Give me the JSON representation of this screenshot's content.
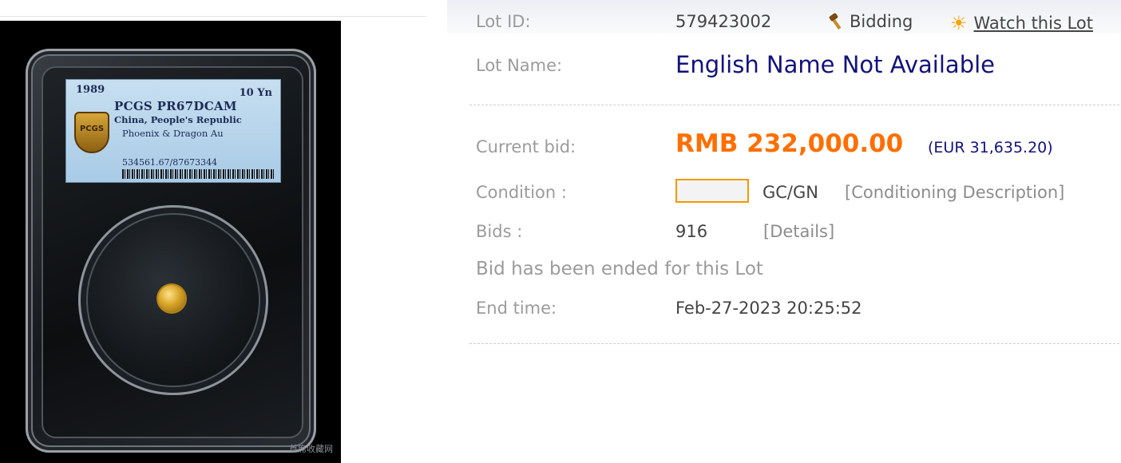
{
  "lot_image": {
    "slab_label": {
      "year": "1989",
      "denomination": "10 Yn",
      "grade": "PCGS PR67DCAM",
      "country": "China, People's Republic",
      "variety": "Phoenix & Dragon Au",
      "cert_number": "534561.67/87673344",
      "logo_text": "PCGS"
    },
    "watermark": "首席收藏网"
  },
  "lot": {
    "id_label": "Lot ID:",
    "id_value": "579423002",
    "status": "Bidding",
    "watch_label": "Watch this Lot",
    "name_label": "Lot Name:",
    "name_value": "English Name Not Available"
  },
  "bid": {
    "current_label": "Current bid:",
    "amount": "RMB 232,000.00",
    "amount_eur": "(EUR 31,635.20)"
  },
  "condition": {
    "label": "Condition :",
    "grade": "GC/GN",
    "description_link": "[Conditioning Description]"
  },
  "bids": {
    "label": "Bids :",
    "count": "916",
    "details_link": "[Details]"
  },
  "ended_message": "Bid has been ended for this Lot",
  "end_time": {
    "label": "End time:",
    "value": "Feb-27-2023 20:25:52"
  },
  "colors": {
    "bid_amount": "#ff6f00",
    "lot_name": "#13127a",
    "label": "#9b9b9b"
  },
  "icons": [
    "hammer-icon",
    "sun-icon"
  ]
}
